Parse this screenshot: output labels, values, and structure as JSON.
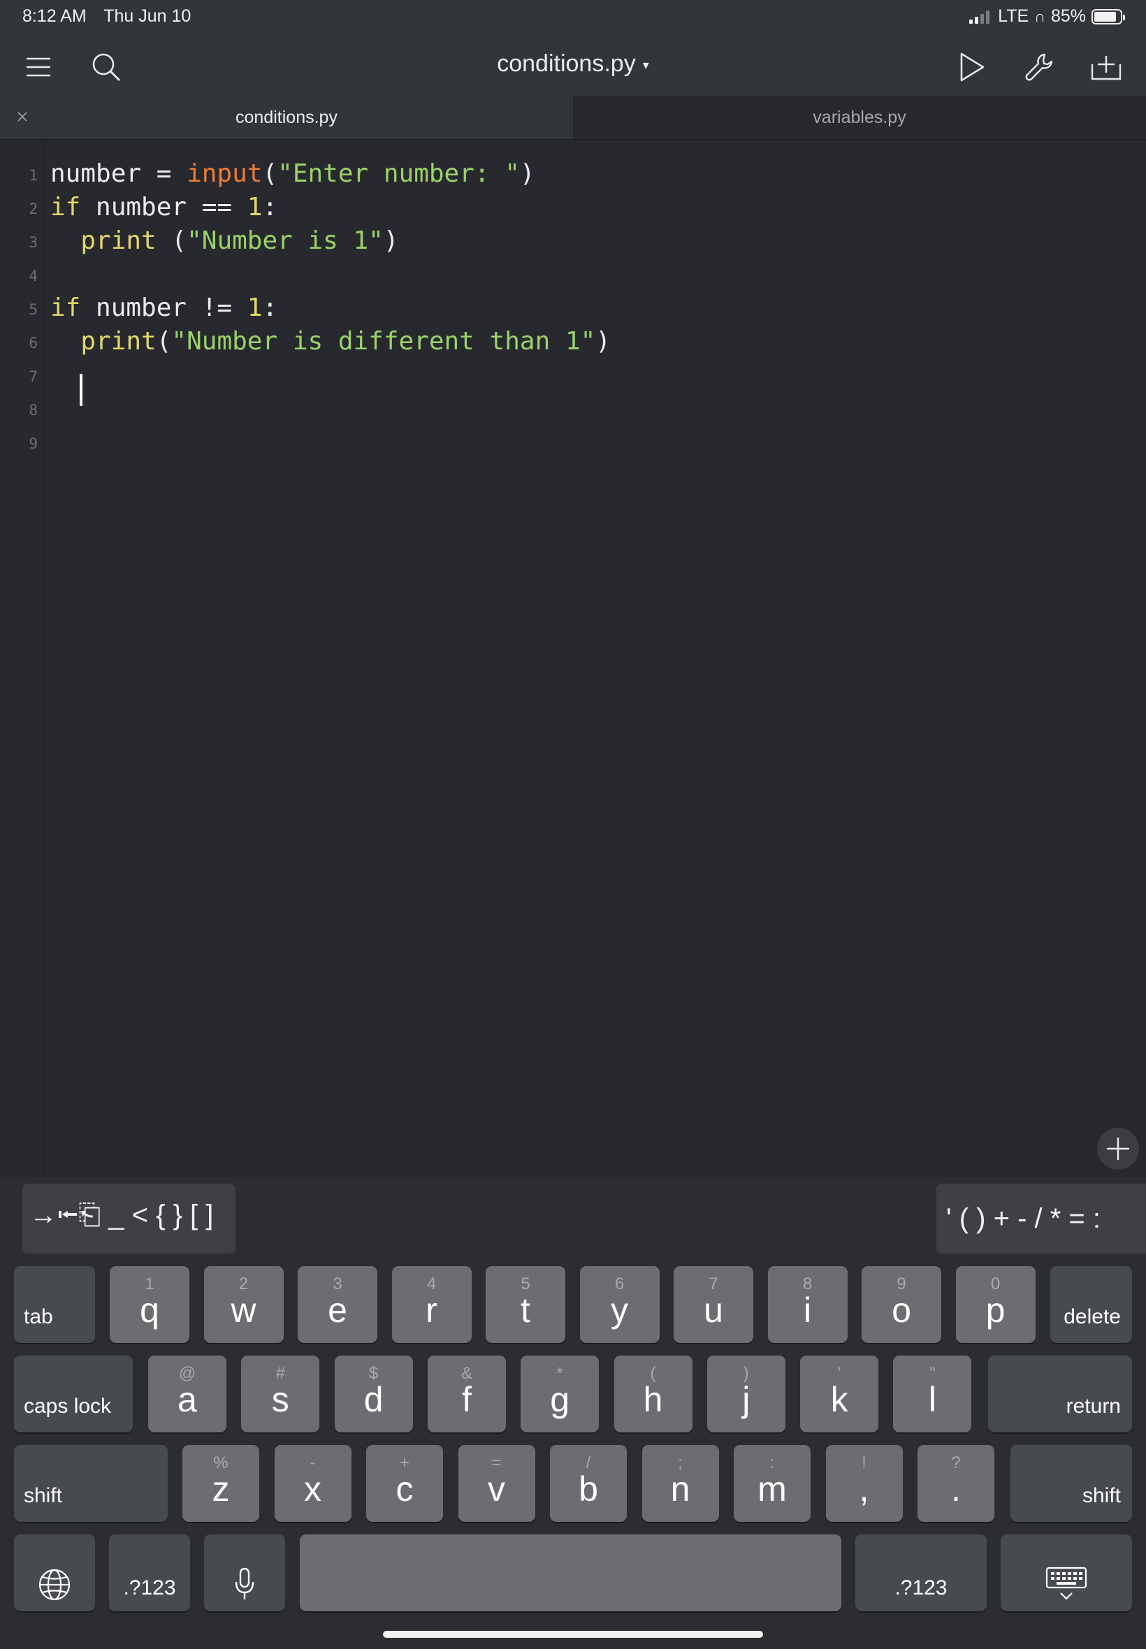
{
  "status_bar": {
    "time": "8:12 AM",
    "date": "Thu Jun 10",
    "network": "LTE",
    "headphones_glyph": "∩",
    "battery": "85%",
    "battery_level": 0.85
  },
  "toolbar": {
    "menu_icon": "hamburger-icon",
    "search_icon": "search-icon",
    "document_title": "conditions.py",
    "title_caret": "▾",
    "run_icon": "play-icon",
    "tools_icon": "wrench-icon",
    "new_icon": "add-file-icon"
  },
  "tabs": [
    {
      "label": "conditions.py",
      "active": true
    },
    {
      "label": "variables.py",
      "active": false
    }
  ],
  "editor": {
    "line_numbers": [
      "1",
      "2",
      "3",
      "4",
      "5",
      "6",
      "7",
      "8",
      "9"
    ],
    "lines": [
      {
        "tokens": [
          {
            "t": "number = ",
            "c": "plain"
          },
          {
            "t": "input",
            "c": "fn"
          },
          {
            "t": "(",
            "c": "plain"
          },
          {
            "t": "\"Enter number: \"",
            "c": "str"
          },
          {
            "t": ")",
            "c": "plain"
          }
        ]
      },
      {
        "tokens": [
          {
            "t": "if",
            "c": "kw"
          },
          {
            "t": " number == ",
            "c": "plain"
          },
          {
            "t": "1",
            "c": "num"
          },
          {
            "t": ":",
            "c": "plain"
          }
        ]
      },
      {
        "tokens": [
          {
            "t": "  ",
            "c": "plain"
          },
          {
            "t": "print",
            "c": "kw"
          },
          {
            "t": " (",
            "c": "plain"
          },
          {
            "t": "\"Number is 1\"",
            "c": "str"
          },
          {
            "t": ")",
            "c": "plain"
          }
        ]
      },
      {
        "tokens": []
      },
      {
        "tokens": [
          {
            "t": "if",
            "c": "kw"
          },
          {
            "t": " number != ",
            "c": "plain"
          },
          {
            "t": "1",
            "c": "num"
          },
          {
            "t": ":",
            "c": "plain"
          }
        ]
      },
      {
        "tokens": [
          {
            "t": "  ",
            "c": "plain"
          },
          {
            "t": "print",
            "c": "kw"
          },
          {
            "t": "(",
            "c": "plain"
          },
          {
            "t": "\"Number is different than 1\"",
            "c": "str"
          },
          {
            "t": ")",
            "c": "plain"
          }
        ]
      },
      {
        "tokens": []
      },
      {
        "tokens": []
      },
      {
        "tokens": []
      }
    ],
    "cursor_line": 7
  },
  "accessory": {
    "left_keys": "→⭰⎗ _ < { } [ ]",
    "right_keys": "' ( ) + - / * = :"
  },
  "keyboard": {
    "row1": [
      {
        "hint": "1",
        "main": "q"
      },
      {
        "hint": "2",
        "main": "w"
      },
      {
        "hint": "3",
        "main": "e"
      },
      {
        "hint": "4",
        "main": "r"
      },
      {
        "hint": "5",
        "main": "t"
      },
      {
        "hint": "6",
        "main": "y"
      },
      {
        "hint": "7",
        "main": "u"
      },
      {
        "hint": "8",
        "main": "i"
      },
      {
        "hint": "9",
        "main": "o"
      },
      {
        "hint": "0",
        "main": "p"
      }
    ],
    "row2": [
      {
        "hint": "@",
        "main": "a"
      },
      {
        "hint": "#",
        "main": "s"
      },
      {
        "hint": "$",
        "main": "d"
      },
      {
        "hint": "&",
        "main": "f"
      },
      {
        "hint": "*",
        "main": "g"
      },
      {
        "hint": "(",
        "main": "h"
      },
      {
        "hint": ")",
        "main": "j"
      },
      {
        "hint": "’",
        "main": "k"
      },
      {
        "hint": "\"",
        "main": "l"
      }
    ],
    "row3": [
      {
        "hint": "%",
        "main": "z"
      },
      {
        "hint": "-",
        "main": "x"
      },
      {
        "hint": "+",
        "main": "c"
      },
      {
        "hint": "=",
        "main": "v"
      },
      {
        "hint": "/",
        "main": "b"
      },
      {
        "hint": ";",
        "main": "n"
      },
      {
        "hint": ":",
        "main": "m"
      },
      {
        "hint": "!",
        "main": ","
      },
      {
        "hint": "?",
        "main": "."
      }
    ],
    "tab": "tab",
    "delete": "delete",
    "caps_lock": "caps lock",
    "return": "return",
    "shift_left": "shift",
    "shift_right": "shift",
    "numbers_left": ".?123",
    "numbers_right": ".?123",
    "globe_icon": "globe-icon",
    "mic_icon": "microphone-icon",
    "dismiss_icon": "keyboard-dismiss-icon"
  }
}
